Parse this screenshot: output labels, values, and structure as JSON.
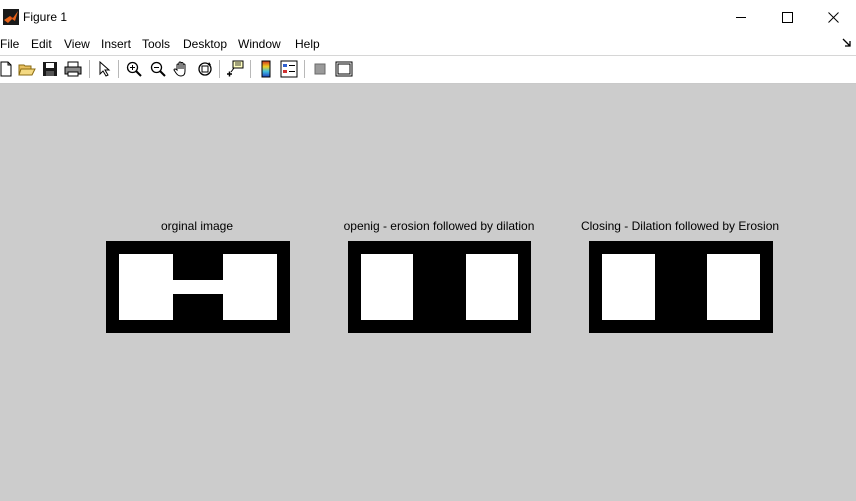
{
  "window": {
    "title": "Figure 1",
    "controls": [
      "minimize",
      "maximize",
      "close"
    ]
  },
  "menu": {
    "items": [
      {
        "label": "File"
      },
      {
        "label": "Edit"
      },
      {
        "label": "View"
      },
      {
        "label": "Insert"
      },
      {
        "label": "Tools"
      },
      {
        "label": "Desktop"
      },
      {
        "label": "Window"
      },
      {
        "label": "Help"
      }
    ]
  },
  "toolbar": {
    "icons": [
      "new-figure-icon",
      "open-file-icon",
      "save-icon",
      "print-icon",
      "pointer-icon",
      "zoom-in-icon",
      "zoom-out-icon",
      "pan-icon",
      "rotate-3d-icon",
      "data-cursor-icon",
      "colorbar-icon",
      "legend-icon",
      "hide-plot-tools-icon",
      "show-plot-tools-icon"
    ]
  },
  "figure": {
    "background": "#cccccc",
    "subplots": [
      {
        "title": "orginal image",
        "content": "two white rectangles joined by a thin white bridge on black"
      },
      {
        "title": "openig - erosion followed by dilation",
        "content": "two separate white rectangles on black"
      },
      {
        "title": "Closing - Dilation followed by Erosion",
        "content": "two separate white rectangles on black"
      }
    ]
  }
}
